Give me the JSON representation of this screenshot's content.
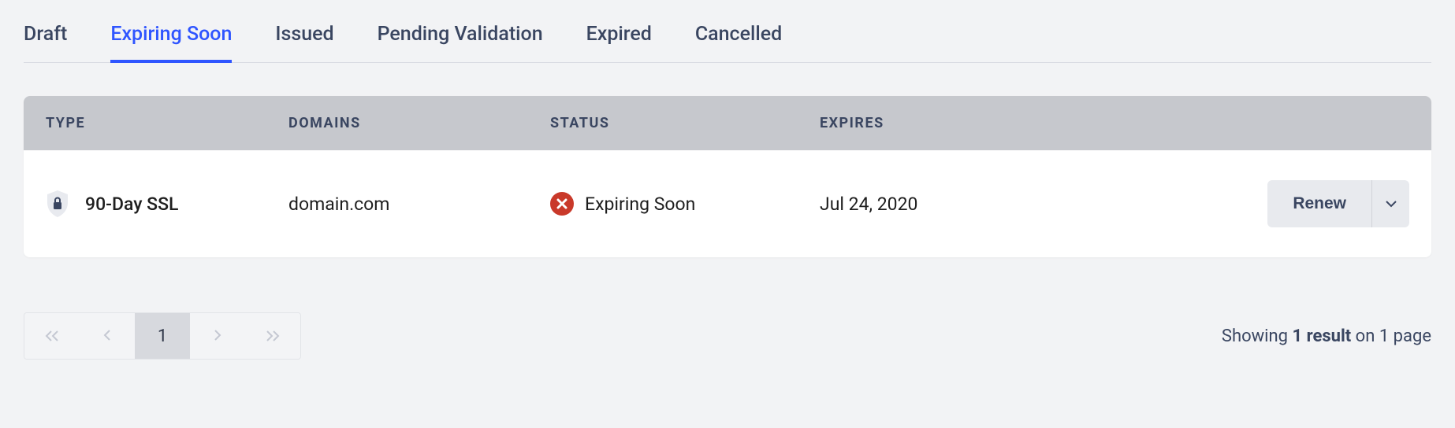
{
  "tabs": [
    {
      "label": "Draft",
      "active": false
    },
    {
      "label": "Expiring Soon",
      "active": true
    },
    {
      "label": "Issued",
      "active": false
    },
    {
      "label": "Pending Validation",
      "active": false
    },
    {
      "label": "Expired",
      "active": false
    },
    {
      "label": "Cancelled",
      "active": false
    }
  ],
  "table": {
    "headers": {
      "type": "TYPE",
      "domains": "DOMAINS",
      "status": "STATUS",
      "expires": "EXPIRES"
    },
    "rows": [
      {
        "type": "90-Day SSL",
        "domain": "domain.com",
        "status": "Expiring Soon",
        "expires": "Jul 24, 2020",
        "action_label": "Renew"
      }
    ]
  },
  "pagination": {
    "current": "1",
    "showing_prefix": "Showing ",
    "result_bold": "1 result",
    "showing_suffix": " on 1 page"
  }
}
